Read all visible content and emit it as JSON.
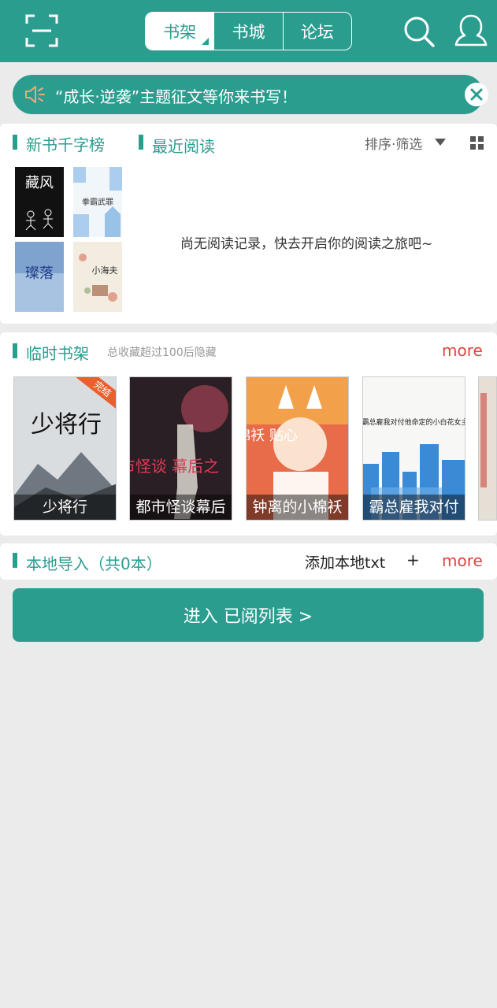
{
  "header": {
    "tabs": [
      {
        "label": "书架",
        "active": true
      },
      {
        "label": "书城",
        "active": false
      },
      {
        "label": "论坛",
        "active": false
      }
    ],
    "icons": {
      "left": "scan-icon",
      "search": "search-icon",
      "user": "user-icon"
    }
  },
  "notice": {
    "text": "“成长·逆袭”主题征文等你来书写！",
    "icon": "speaker-icon",
    "close_icon": "close-icon"
  },
  "shelf": {
    "tab_new": "新书千字榜",
    "tab_recent": "最近阅读",
    "sort_label": "排序·筛选",
    "empty_text": "尚无阅读记录，快去开启你的阅读之旅吧~",
    "mini_covers": [
      "藏风",
      "拳霸武罪",
      "璨落",
      "小海夫"
    ]
  },
  "temp_shelf": {
    "title": "临时书架",
    "hint": "总收藏超过100后隐藏",
    "more": "more",
    "books": [
      {
        "title": "少将行",
        "badge": "完结",
        "cover_text": "少将行"
      },
      {
        "title": "都市怪谈幕后",
        "cover_text": "都市怪谈 幕后之"
      },
      {
        "title": "钟离的小棉袄",
        "cover_text": "棉袄 贴心"
      },
      {
        "title": "霸总雇我对付",
        "cover_text": "霸总雇我对付他命定的小白花女主"
      }
    ]
  },
  "local": {
    "title": "本地导入（共0本）",
    "add_label": "添加本地txt",
    "add_icon": "+",
    "more": "more"
  },
  "enter_button": "进入 已阅列表 >",
  "colors": {
    "primary": "#2a9d8f",
    "accent": "#e0443f"
  }
}
